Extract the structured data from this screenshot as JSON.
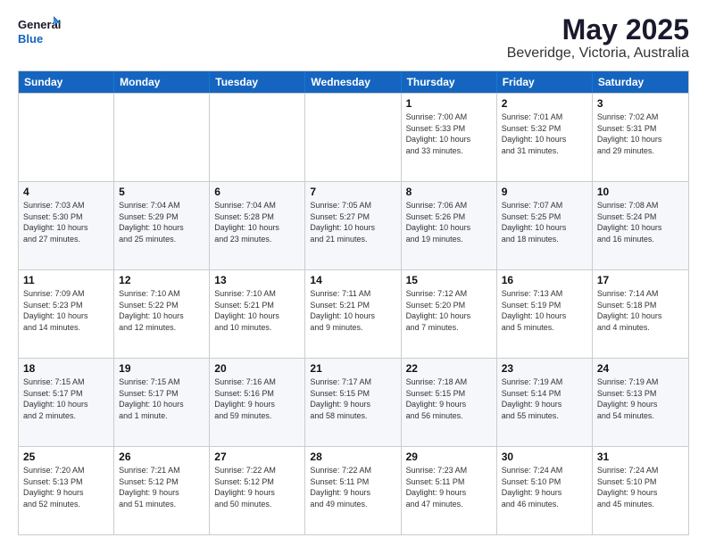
{
  "logo": {
    "line1": "General",
    "line2": "Blue"
  },
  "title": "May 2025",
  "subtitle": "Beveridge, Victoria, Australia",
  "days": [
    "Sunday",
    "Monday",
    "Tuesday",
    "Wednesday",
    "Thursday",
    "Friday",
    "Saturday"
  ],
  "weeks": [
    [
      {
        "day": "",
        "info": ""
      },
      {
        "day": "",
        "info": ""
      },
      {
        "day": "",
        "info": ""
      },
      {
        "day": "",
        "info": ""
      },
      {
        "day": "1",
        "info": "Sunrise: 7:00 AM\nSunset: 5:33 PM\nDaylight: 10 hours\nand 33 minutes."
      },
      {
        "day": "2",
        "info": "Sunrise: 7:01 AM\nSunset: 5:32 PM\nDaylight: 10 hours\nand 31 minutes."
      },
      {
        "day": "3",
        "info": "Sunrise: 7:02 AM\nSunset: 5:31 PM\nDaylight: 10 hours\nand 29 minutes."
      }
    ],
    [
      {
        "day": "4",
        "info": "Sunrise: 7:03 AM\nSunset: 5:30 PM\nDaylight: 10 hours\nand 27 minutes."
      },
      {
        "day": "5",
        "info": "Sunrise: 7:04 AM\nSunset: 5:29 PM\nDaylight: 10 hours\nand 25 minutes."
      },
      {
        "day": "6",
        "info": "Sunrise: 7:04 AM\nSunset: 5:28 PM\nDaylight: 10 hours\nand 23 minutes."
      },
      {
        "day": "7",
        "info": "Sunrise: 7:05 AM\nSunset: 5:27 PM\nDaylight: 10 hours\nand 21 minutes."
      },
      {
        "day": "8",
        "info": "Sunrise: 7:06 AM\nSunset: 5:26 PM\nDaylight: 10 hours\nand 19 minutes."
      },
      {
        "day": "9",
        "info": "Sunrise: 7:07 AM\nSunset: 5:25 PM\nDaylight: 10 hours\nand 18 minutes."
      },
      {
        "day": "10",
        "info": "Sunrise: 7:08 AM\nSunset: 5:24 PM\nDaylight: 10 hours\nand 16 minutes."
      }
    ],
    [
      {
        "day": "11",
        "info": "Sunrise: 7:09 AM\nSunset: 5:23 PM\nDaylight: 10 hours\nand 14 minutes."
      },
      {
        "day": "12",
        "info": "Sunrise: 7:10 AM\nSunset: 5:22 PM\nDaylight: 10 hours\nand 12 minutes."
      },
      {
        "day": "13",
        "info": "Sunrise: 7:10 AM\nSunset: 5:21 PM\nDaylight: 10 hours\nand 10 minutes."
      },
      {
        "day": "14",
        "info": "Sunrise: 7:11 AM\nSunset: 5:21 PM\nDaylight: 10 hours\nand 9 minutes."
      },
      {
        "day": "15",
        "info": "Sunrise: 7:12 AM\nSunset: 5:20 PM\nDaylight: 10 hours\nand 7 minutes."
      },
      {
        "day": "16",
        "info": "Sunrise: 7:13 AM\nSunset: 5:19 PM\nDaylight: 10 hours\nand 5 minutes."
      },
      {
        "day": "17",
        "info": "Sunrise: 7:14 AM\nSunset: 5:18 PM\nDaylight: 10 hours\nand 4 minutes."
      }
    ],
    [
      {
        "day": "18",
        "info": "Sunrise: 7:15 AM\nSunset: 5:17 PM\nDaylight: 10 hours\nand 2 minutes."
      },
      {
        "day": "19",
        "info": "Sunrise: 7:15 AM\nSunset: 5:17 PM\nDaylight: 10 hours\nand 1 minute."
      },
      {
        "day": "20",
        "info": "Sunrise: 7:16 AM\nSunset: 5:16 PM\nDaylight: 9 hours\nand 59 minutes."
      },
      {
        "day": "21",
        "info": "Sunrise: 7:17 AM\nSunset: 5:15 PM\nDaylight: 9 hours\nand 58 minutes."
      },
      {
        "day": "22",
        "info": "Sunrise: 7:18 AM\nSunset: 5:15 PM\nDaylight: 9 hours\nand 56 minutes."
      },
      {
        "day": "23",
        "info": "Sunrise: 7:19 AM\nSunset: 5:14 PM\nDaylight: 9 hours\nand 55 minutes."
      },
      {
        "day": "24",
        "info": "Sunrise: 7:19 AM\nSunset: 5:13 PM\nDaylight: 9 hours\nand 54 minutes."
      }
    ],
    [
      {
        "day": "25",
        "info": "Sunrise: 7:20 AM\nSunset: 5:13 PM\nDaylight: 9 hours\nand 52 minutes."
      },
      {
        "day": "26",
        "info": "Sunrise: 7:21 AM\nSunset: 5:12 PM\nDaylight: 9 hours\nand 51 minutes."
      },
      {
        "day": "27",
        "info": "Sunrise: 7:22 AM\nSunset: 5:12 PM\nDaylight: 9 hours\nand 50 minutes."
      },
      {
        "day": "28",
        "info": "Sunrise: 7:22 AM\nSunset: 5:11 PM\nDaylight: 9 hours\nand 49 minutes."
      },
      {
        "day": "29",
        "info": "Sunrise: 7:23 AM\nSunset: 5:11 PM\nDaylight: 9 hours\nand 47 minutes."
      },
      {
        "day": "30",
        "info": "Sunrise: 7:24 AM\nSunset: 5:10 PM\nDaylight: 9 hours\nand 46 minutes."
      },
      {
        "day": "31",
        "info": "Sunrise: 7:24 AM\nSunset: 5:10 PM\nDaylight: 9 hours\nand 45 minutes."
      }
    ]
  ]
}
